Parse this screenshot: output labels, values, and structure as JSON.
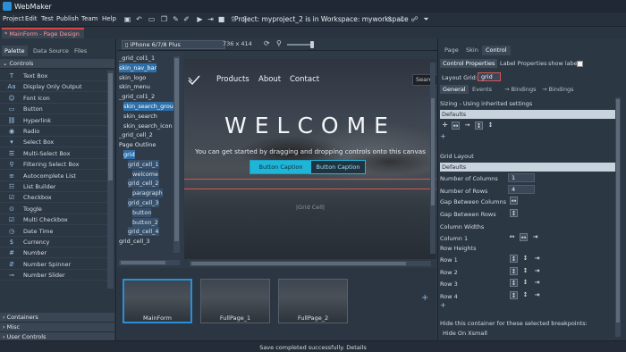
{
  "app": {
    "name": "WebMaker"
  },
  "menu": [
    "Project",
    "Edit",
    "Test",
    "Publish",
    "Team",
    "Help"
  ],
  "toolbar_icons": [
    "save-icon",
    "undo-icon",
    "redo-icon",
    "grid-icon",
    "monitor-icon",
    "pages-icon",
    "eyedropper-icon",
    "brush-icon",
    "play-icon",
    "run-icon",
    "stop-icon",
    "deploy-icon",
    "publish-icon",
    "upload-icon",
    "download-icon",
    "team-icon"
  ],
  "project_text": "Project: myproject_2 is in Workspace: myworkspace",
  "doc_tab": {
    "label": "* MainForm - Page Design"
  },
  "palette": {
    "tabs": [
      "Palette",
      "Data Source",
      "Files"
    ],
    "category_open": "Controls",
    "items": [
      {
        "icon": "T",
        "label": "Text Box"
      },
      {
        "icon": "Aa",
        "label": "Display Only Output"
      },
      {
        "icon": "☺",
        "label": "Font Icon"
      },
      {
        "icon": "▭",
        "label": "Button"
      },
      {
        "icon": "⛓",
        "label": "Hyperlink"
      },
      {
        "icon": "◉",
        "label": "Radio"
      },
      {
        "icon": "▾",
        "label": "Select Box"
      },
      {
        "icon": "☰",
        "label": "Multi-Select Box"
      },
      {
        "icon": "⚲",
        "label": "Filtering Select Box"
      },
      {
        "icon": "≡",
        "label": "Autocomplete List"
      },
      {
        "icon": "☷",
        "label": "List Builder"
      },
      {
        "icon": "☑",
        "label": "Checkbox"
      },
      {
        "icon": "⊙",
        "label": "Toggle"
      },
      {
        "icon": "☑",
        "label": "Multi Checkbox"
      },
      {
        "icon": "◷",
        "label": "Date Time"
      },
      {
        "icon": "$",
        "label": "Currency"
      },
      {
        "icon": "#",
        "label": "Number"
      },
      {
        "icon": "⇵",
        "label": "Number Spinner"
      },
      {
        "icon": "⊸",
        "label": "Number Slider"
      }
    ],
    "bottom_categories": [
      "Containers",
      "Misc",
      "User Controls"
    ]
  },
  "device_bar": {
    "device": "iPhone 6/7/8 Plus",
    "size": "736 x 414"
  },
  "outline": {
    "items": [
      {
        "label": "_grid_col1_1",
        "indent": 0,
        "sel": false,
        "hl": false
      },
      {
        "label": "skin_nav_bar",
        "indent": 0,
        "sel": true,
        "hl": false
      },
      {
        "label": "skin_logo",
        "indent": 0,
        "sel": false,
        "hl": false
      },
      {
        "label": "skin_menu",
        "indent": 0,
        "sel": false,
        "hl": false
      },
      {
        "label": "_grid_col1_2",
        "indent": 0,
        "sel": false,
        "hl": false
      },
      {
        "label": "skin_search_group",
        "indent": 1,
        "sel": true,
        "hl": false
      },
      {
        "label": "skin_search",
        "indent": 1,
        "sel": false,
        "hl": false
      },
      {
        "label": "skin_search_icon",
        "indent": 1,
        "sel": false,
        "hl": false
      },
      {
        "label": "_grid_cell_2",
        "indent": 0,
        "sel": false,
        "hl": false
      },
      {
        "label": "Page Outline",
        "indent": 0,
        "sel": false,
        "hl": false
      },
      {
        "label": "grid",
        "indent": 1,
        "sel": true,
        "hl": false
      },
      {
        "label": "grid_cell_1",
        "indent": 2,
        "sel": false,
        "hl": true
      },
      {
        "label": "welcome",
        "indent": 3,
        "sel": false,
        "hl": true
      },
      {
        "label": "grid_cell_2",
        "indent": 2,
        "sel": false,
        "hl": true
      },
      {
        "label": "paragraph",
        "indent": 3,
        "sel": false,
        "hl": true
      },
      {
        "label": "grid_cell_3",
        "indent": 2,
        "sel": false,
        "hl": true
      },
      {
        "label": "button",
        "indent": 3,
        "sel": false,
        "hl": true
      },
      {
        "label": "button_2",
        "indent": 3,
        "sel": false,
        "hl": true
      },
      {
        "label": "grid_cell_4",
        "indent": 2,
        "sel": false,
        "hl": true
      },
      {
        "label": "grid_cell_3",
        "indent": 0,
        "sel": false,
        "hl": false
      }
    ]
  },
  "canvas": {
    "nav": [
      "Products",
      "About",
      "Contact"
    ],
    "search_placeholder": "Search",
    "heading": "WELCOME",
    "tagline": "You can get started by dragging and dropping controls onto this canvas",
    "button1": "Button Caption",
    "button2": "Button Caption",
    "grid_cell": "|Grid Cell|"
  },
  "pages": {
    "cards": [
      {
        "label": "MainForm",
        "selected": true
      },
      {
        "label": "FullPage_1",
        "selected": false
      },
      {
        "label": "FullPage_2",
        "selected": false
      }
    ],
    "add_symbol": "+"
  },
  "properties": {
    "tabs": [
      "Page",
      "Skin",
      "Control"
    ],
    "subtabs": [
      "Control Properties",
      "Label Properties",
      "show label"
    ],
    "layout_grid_label": "Layout Grid:",
    "layout_grid_value": "grid",
    "sections": [
      "General",
      "Events",
      "→ Bindings",
      "→ Bindings"
    ],
    "sizing": "Sizing - Using inherited settings",
    "defaults": "Defaults",
    "grid_layout": "Grid Layout",
    "defaults2": "Defaults",
    "fields": [
      {
        "label": "Number of Columns",
        "value": "1"
      },
      {
        "label": "Number of Rows",
        "value": "4"
      }
    ],
    "gap_columns": "Gap Between Columns",
    "gap_rows": "Gap Between Rows",
    "column_widths": "Column Widths",
    "column1": "Column 1",
    "row_heights": "Row Heights",
    "rows": [
      "Row 1",
      "Row 2",
      "Row 3",
      "Row 4"
    ],
    "hide_text": "Hide this container for these selected breakpoints:",
    "hide_option": "Hide On Xsmall"
  },
  "status": "Save completed successfully. Details",
  "colors": {
    "accent": "#2a8fd6",
    "button_cyan": "#1fb5d8",
    "highlight_red": "#d65454",
    "background": "#2f3a47"
  }
}
